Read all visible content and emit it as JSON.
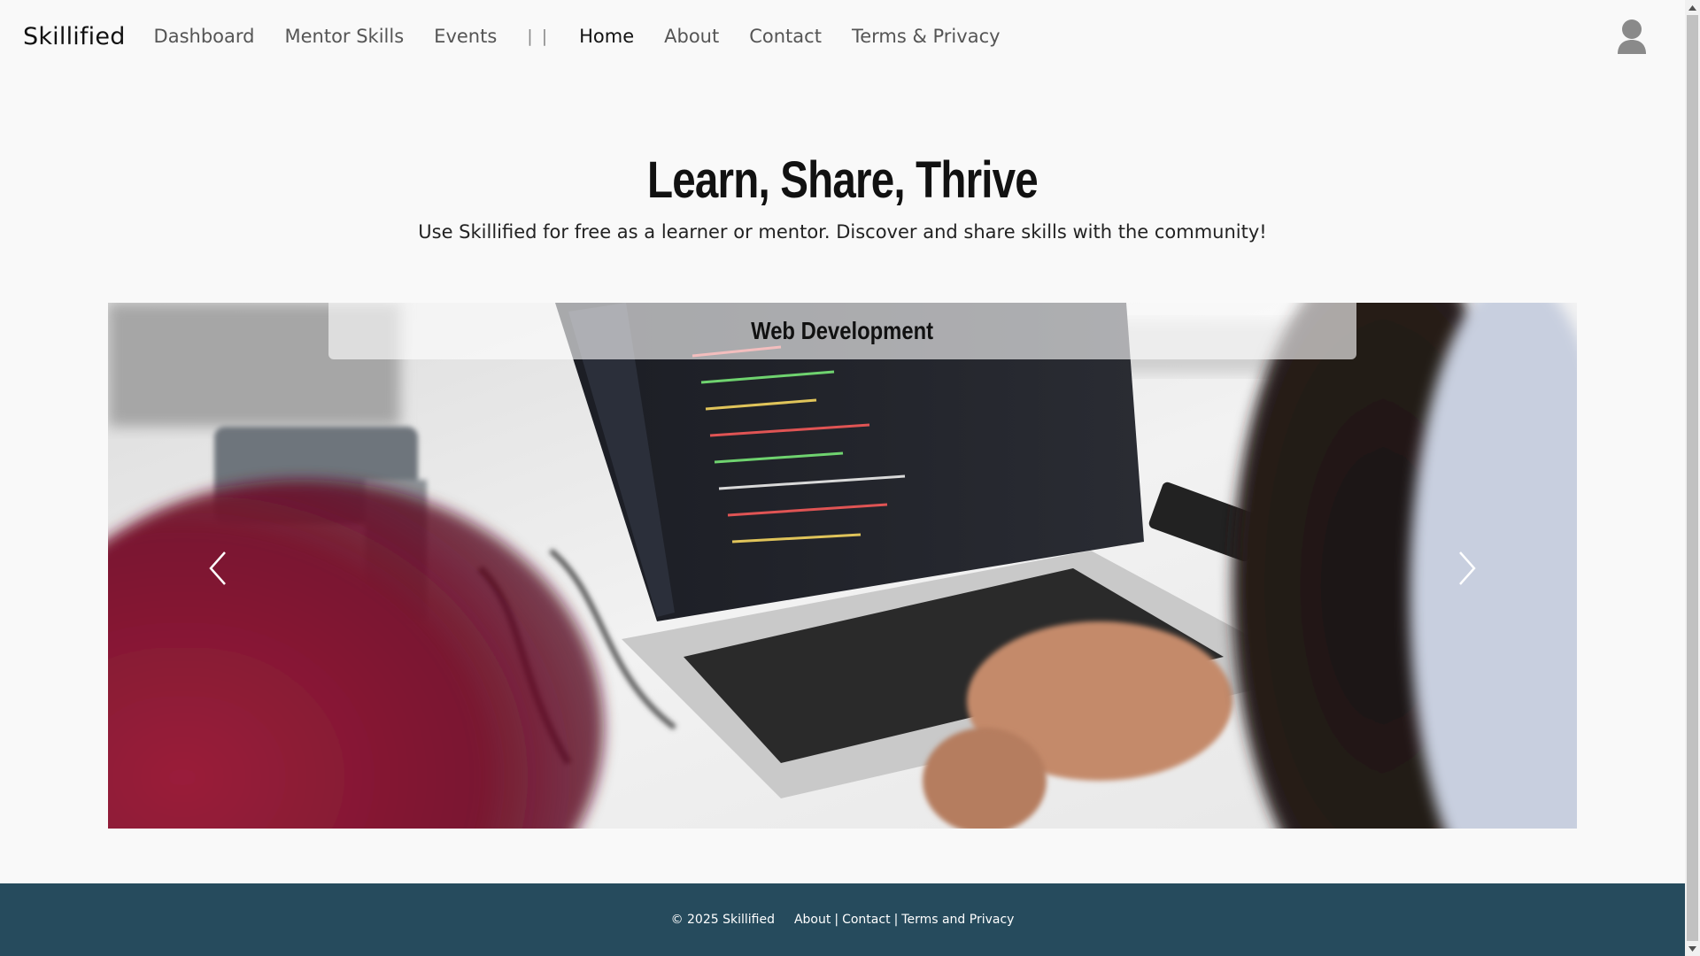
{
  "nav": {
    "brand": "Skillified",
    "links": [
      {
        "label": "Dashboard"
      },
      {
        "label": "Mentor Skills"
      },
      {
        "label": "Events"
      }
    ],
    "separator": "| |",
    "secondary_links": [
      {
        "label": "Home",
        "active": true
      },
      {
        "label": "About"
      },
      {
        "label": "Contact"
      },
      {
        "label": "Terms & Privacy"
      }
    ],
    "avatar_icon": "user-avatar-icon"
  },
  "hero": {
    "title": "Learn, Share, Thrive",
    "subtitle": "Use Skillified for free as a learner or mentor. Discover and share skills with the community!"
  },
  "carousel": {
    "caption": "Web Development",
    "prev_icon": "chevron-left-icon",
    "next_icon": "chevron-right-icon"
  },
  "footer": {
    "copyright": "© 2025 Skillified",
    "links": [
      {
        "label": "About"
      },
      {
        "label": "Contact"
      },
      {
        "label": "Terms and Privacy"
      }
    ],
    "separator": "|",
    "background": "#264b5d"
  }
}
